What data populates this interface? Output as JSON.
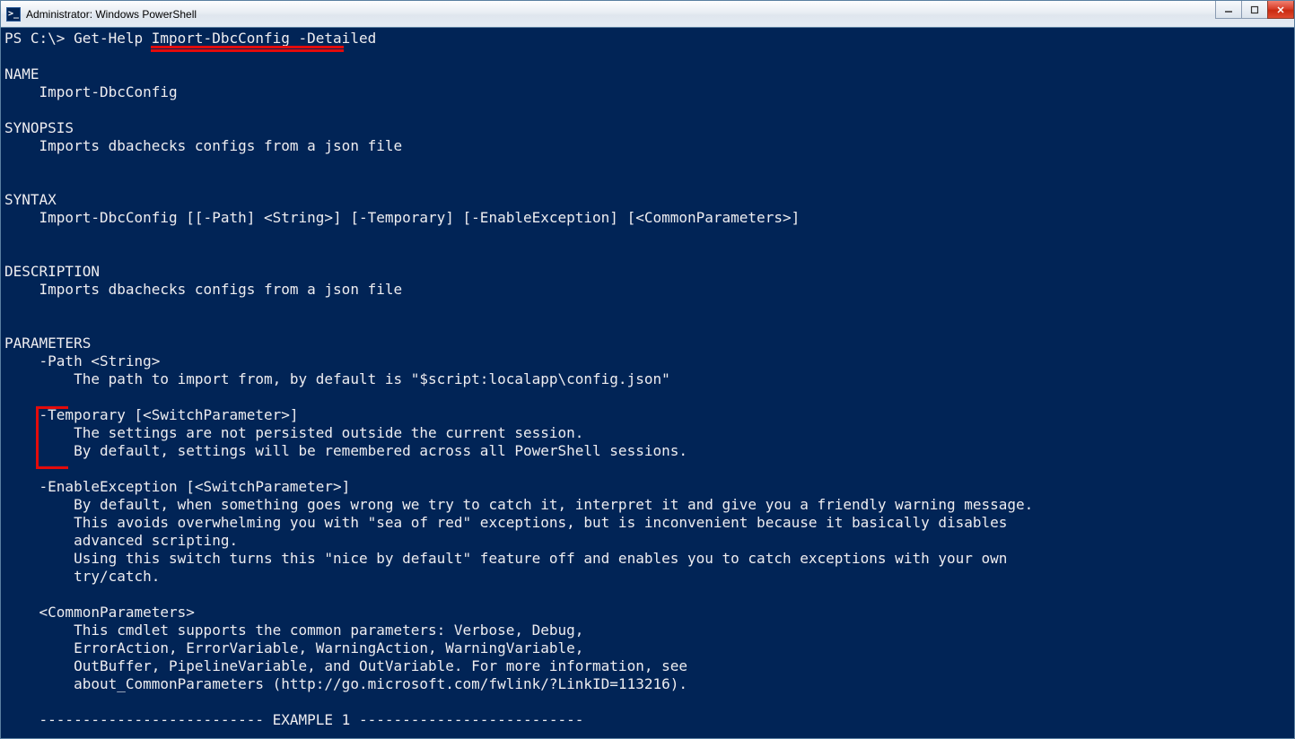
{
  "window": {
    "title": "Administrator: Windows PowerShell",
    "icon_glyph": ">_"
  },
  "terminal": {
    "prompt": "PS C:\\> ",
    "command": "Get-Help Import-DbcConfig -Detailed",
    "sections": {
      "name_header": "NAME",
      "name_value": "    Import-DbcConfig",
      "synopsis_header": "SYNOPSIS",
      "synopsis_value": "    Imports dbachecks configs from a json file",
      "syntax_header": "SYNTAX",
      "syntax_value": "    Import-DbcConfig [[-Path] <String>] [-Temporary] [-EnableException] [<CommonParameters>]",
      "description_header": "DESCRIPTION",
      "description_value": "    Imports dbachecks configs from a json file",
      "parameters_header": "PARAMETERS",
      "param_path_name": "    -Path <String>",
      "param_path_desc": "        The path to import from, by default is \"$script:localapp\\config.json\"",
      "param_temp_name": "    -Temporary [<SwitchParameter>]",
      "param_temp_desc1": "        The settings are not persisted outside the current session.",
      "param_temp_desc2": "        By default, settings will be remembered across all PowerShell sessions.",
      "param_ee_name": "    -EnableException [<SwitchParameter>]",
      "param_ee_desc1": "        By default, when something goes wrong we try to catch it, interpret it and give you a friendly warning message.",
      "param_ee_desc2": "        This avoids overwhelming you with \"sea of red\" exceptions, but is inconvenient because it basically disables",
      "param_ee_desc3": "        advanced scripting.",
      "param_ee_desc4": "        Using this switch turns this \"nice by default\" feature off and enables you to catch exceptions with your own",
      "param_ee_desc5": "        try/catch.",
      "common_name": "    <CommonParameters>",
      "common_desc1": "        This cmdlet supports the common parameters: Verbose, Debug,",
      "common_desc2": "        ErrorAction, ErrorVariable, WarningAction, WarningVariable,",
      "common_desc3": "        OutBuffer, PipelineVariable, and OutVariable. For more information, see",
      "common_desc4": "        about_CommonParameters (http://go.microsoft.com/fwlink/?LinkID=113216).",
      "example_header": "    -------------------------- EXAMPLE 1 --------------------------"
    }
  },
  "annotation_colors": {
    "red": "#e30b0b"
  }
}
